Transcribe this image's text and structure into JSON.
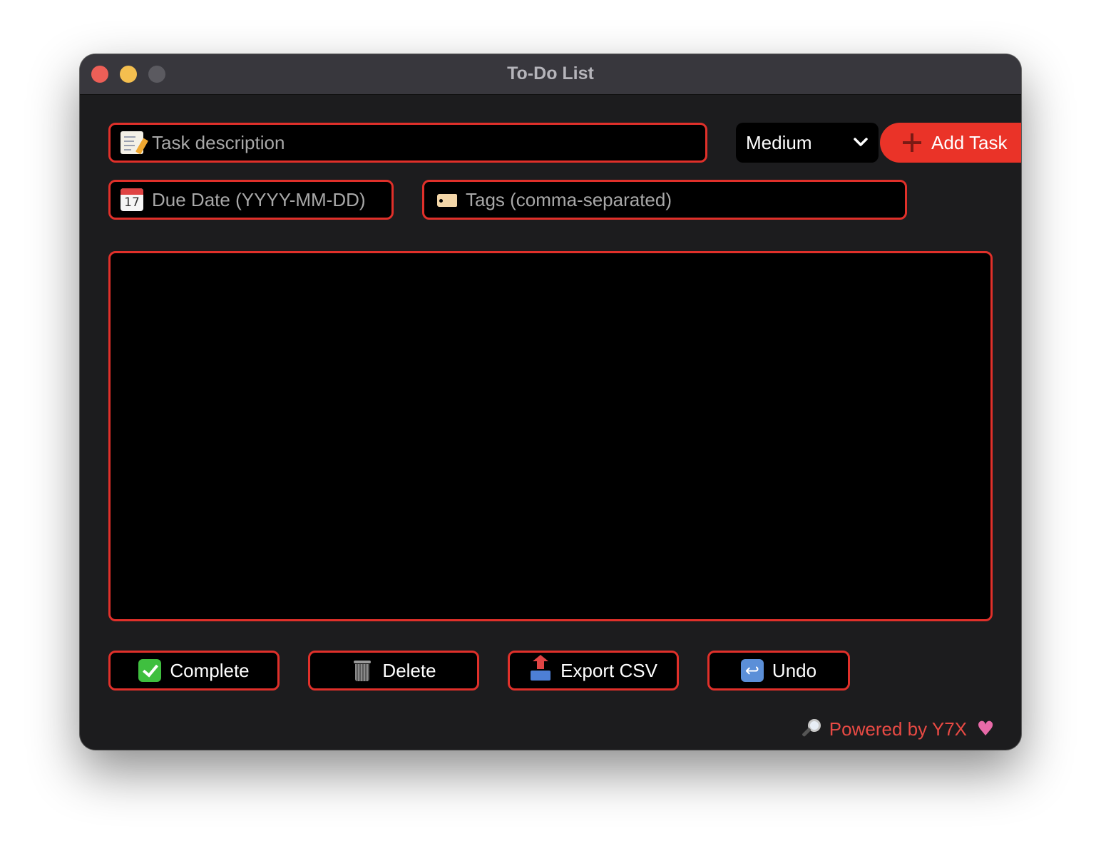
{
  "window": {
    "title": "To-Do List"
  },
  "form": {
    "task_placeholder": "Task description",
    "due_placeholder": "Due Date (YYYY-MM-DD)",
    "tags_placeholder": "Tags (comma-separated)",
    "priority_value": "Medium",
    "add_button_label": "Add Task",
    "icons": {
      "task": "memo-icon",
      "due": "calendar-icon",
      "tags": "tag-icon",
      "add": "plus-icon"
    },
    "calendar_icon_day": "17"
  },
  "actions": {
    "complete_label": "Complete",
    "delete_label": "Delete",
    "export_label": "Export CSV",
    "undo_label": "Undo"
  },
  "footer": {
    "text": "Powered by Y7X",
    "left_icon": "magnifier-icon",
    "right_icon": "heart-icon"
  },
  "colors": {
    "accent": "#e0302a",
    "add_button": "#ea3328",
    "window_bg": "#1c1c1e",
    "field_bg": "#000000",
    "footer_text": "#e84a44"
  }
}
